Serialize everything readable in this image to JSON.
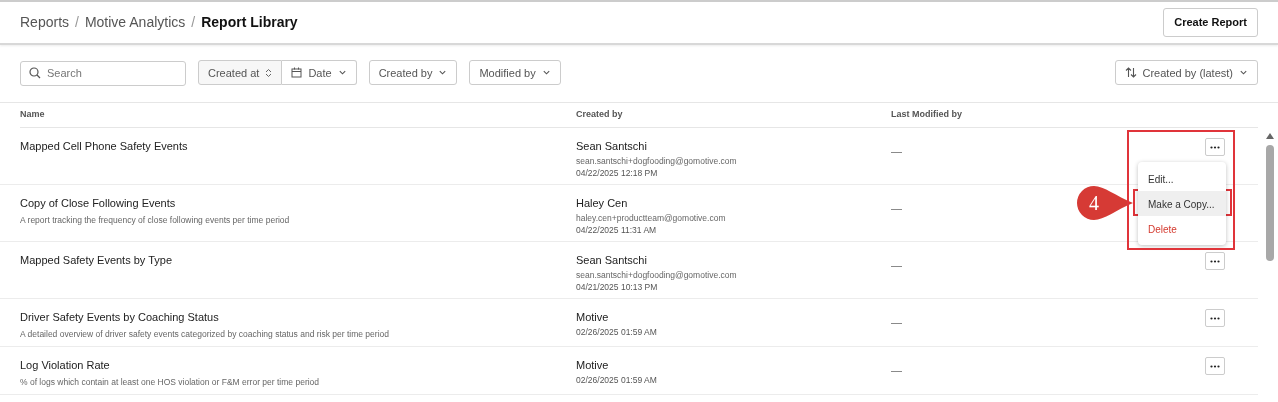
{
  "breadcrumb": [
    {
      "label": "Reports",
      "current": false
    },
    {
      "label": "Motive Analytics",
      "current": false
    },
    {
      "label": "Report Library",
      "current": true
    }
  ],
  "breadcrumb_separator": "/",
  "create_button": "Create Report",
  "search": {
    "placeholder": "Search"
  },
  "filters": {
    "created_at": "Created at",
    "date": "Date",
    "created_by": "Created by",
    "modified_by": "Modified by"
  },
  "sort": "Created by (latest)",
  "table": {
    "columns": [
      "Name",
      "Created by",
      "Last Modified by"
    ],
    "rows": [
      {
        "name": "Mapped Cell Phone Safety Events",
        "creator": "Sean Santschi",
        "email": "sean.santschi+dogfooding@gomotive.com",
        "date": "04/22/2025 12:18 PM",
        "modified": "—",
        "menu": [
          {
            "label": "Edit...",
            "kind": "normal",
            "highlighted": false
          },
          {
            "label": "Make a Copy...",
            "kind": "normal",
            "highlighted": true
          },
          {
            "label": "Delete",
            "kind": "danger",
            "highlighted": false
          }
        ]
      },
      {
        "name": "Copy of Close Following Events",
        "description": "A report tracking the frequency of close following events per time period",
        "creator": "Haley Cen",
        "email": "haley.cen+productteam@gomotive.com",
        "date": "04/22/2025 11:31 AM",
        "modified": "—"
      },
      {
        "name": "Mapped Safety Events by Type",
        "creator": "Sean Santschi",
        "email": "sean.santschi+dogfooding@gomotive.com",
        "date": "04/21/2025 10:13 PM",
        "modified": "—"
      },
      {
        "name": "Driver Safety Events by Coaching Status",
        "description": "A detailed overview of driver safety events categorized by coaching status and risk per time period",
        "creator": "Motive",
        "date": "02/26/2025 01:59 AM",
        "modified": "—"
      },
      {
        "name": "Log Violation Rate",
        "description": "% of logs which contain at least one HOS violation or F&M error per time period",
        "creator": "Motive",
        "date": "02/26/2025 01:59 AM",
        "modified": "—"
      }
    ]
  },
  "annotation": {
    "step": "4"
  }
}
